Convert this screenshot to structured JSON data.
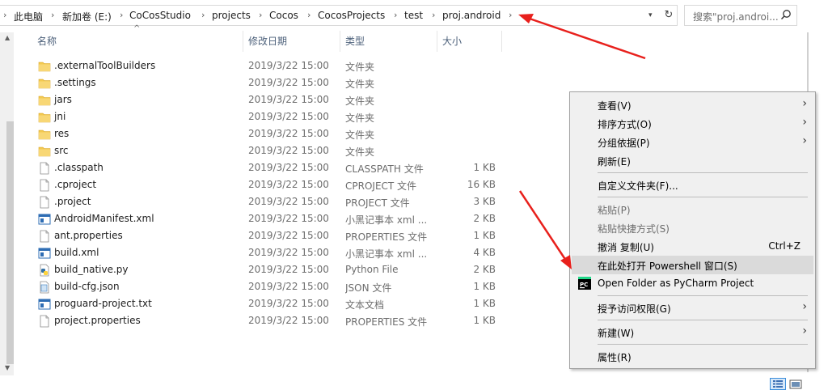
{
  "address_bar": {
    "crumbs": [
      "此电脑",
      "新加卷 (E:)",
      "CoCosStudio",
      "projects",
      "Cocos",
      "CocosProjects",
      "test",
      "proj.android"
    ],
    "search_placeholder": "搜索\"proj.androi..."
  },
  "columns": {
    "name": "名称",
    "date": "修改日期",
    "type": "类型",
    "size": "大小"
  },
  "files": [
    {
      "name": ".externalToolBuilders",
      "date": "2019/3/22 15:00",
      "type": "文件夹",
      "size": "",
      "icon": "folder-icon"
    },
    {
      "name": ".settings",
      "date": "2019/3/22 15:00",
      "type": "文件夹",
      "size": "",
      "icon": "folder-icon"
    },
    {
      "name": "jars",
      "date": "2019/3/22 15:00",
      "type": "文件夹",
      "size": "",
      "icon": "folder-icon"
    },
    {
      "name": "jni",
      "date": "2019/3/22 15:00",
      "type": "文件夹",
      "size": "",
      "icon": "folder-icon"
    },
    {
      "name": "res",
      "date": "2019/3/22 15:00",
      "type": "文件夹",
      "size": "",
      "icon": "folder-icon"
    },
    {
      "name": "src",
      "date": "2019/3/22 15:00",
      "type": "文件夹",
      "size": "",
      "icon": "folder-icon"
    },
    {
      "name": ".classpath",
      "date": "2019/3/22 15:00",
      "type": "CLASSPATH 文件",
      "size": "1 KB",
      "icon": "file-icon"
    },
    {
      "name": ".cproject",
      "date": "2019/3/22 15:00",
      "type": "CPROJECT 文件",
      "size": "16 KB",
      "icon": "file-icon"
    },
    {
      "name": ".project",
      "date": "2019/3/22 15:00",
      "type": "PROJECT 文件",
      "size": "3 KB",
      "icon": "file-icon"
    },
    {
      "name": "AndroidManifest.xml",
      "date": "2019/3/22 15:00",
      "type": "小黑记事本 xml ...",
      "size": "2 KB",
      "icon": "xml-file-icon"
    },
    {
      "name": "ant.properties",
      "date": "2019/3/22 15:00",
      "type": "PROPERTIES 文件",
      "size": "1 KB",
      "icon": "file-icon"
    },
    {
      "name": "build.xml",
      "date": "2019/3/22 15:00",
      "type": "小黑记事本 xml ...",
      "size": "4 KB",
      "icon": "xml-file-icon"
    },
    {
      "name": "build_native.py",
      "date": "2019/3/22 15:00",
      "type": "Python File",
      "size": "2 KB",
      "icon": "python-file-icon"
    },
    {
      "name": "build-cfg.json",
      "date": "2019/3/22 15:00",
      "type": "JSON 文件",
      "size": "1 KB",
      "icon": "json-file-icon"
    },
    {
      "name": "proguard-project.txt",
      "date": "2019/3/22 15:00",
      "type": "文本文档",
      "size": "1 KB",
      "icon": "text-file-icon"
    },
    {
      "name": "project.properties",
      "date": "2019/3/22 15:00",
      "type": "PROPERTIES 文件",
      "size": "1 KB",
      "icon": "file-icon"
    }
  ],
  "context_menu": {
    "view": "查看(V)",
    "sort_by": "排序方式(O)",
    "group_by": "分组依据(P)",
    "refresh": "刷新(E)",
    "customize_folder": "自定义文件夹(F)...",
    "paste": "粘贴(P)",
    "paste_shortcut": "粘贴快捷方式(S)",
    "undo_copy": "撤消 复制(U)",
    "undo_copy_shortcut": "Ctrl+Z",
    "open_powershell": "在此处打开 Powershell 窗口(S)",
    "open_pycharm": "Open Folder as PyCharm Project",
    "grant_access": "授予访问权限(G)",
    "new": "新建(W)",
    "properties": "属性(R)"
  },
  "colors": {
    "folder": "#f3c94f",
    "annotation_arrow": "#e8201c",
    "menu_highlight": "#dadada",
    "header_text": "#4c607a"
  }
}
